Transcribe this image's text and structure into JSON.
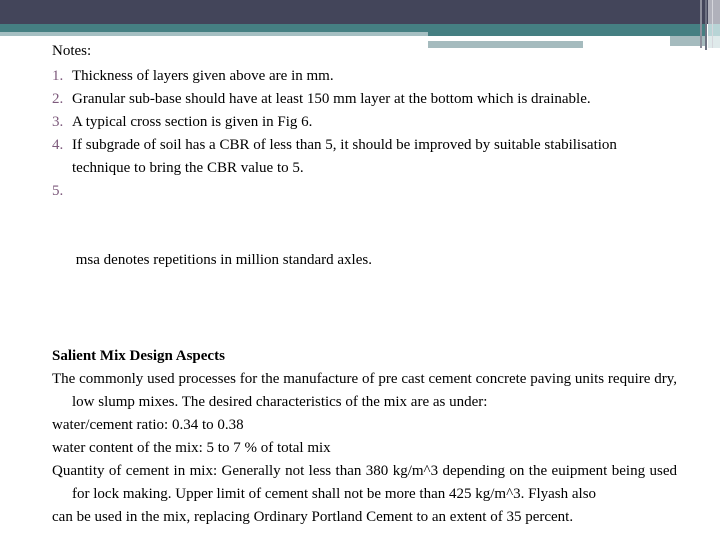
{
  "header": {
    "colors": {
      "dark_band": "#43455a",
      "teal_band": "#457f82",
      "light_strip": "#a5bfc2"
    }
  },
  "notes": {
    "title": "Notes:",
    "number_color": "#7d5a7c",
    "items": [
      {
        "num": "1.",
        "text": "Thickness of layers given above are in mm."
      },
      {
        "num": "2.",
        "text": "Granular sub-base should have at least 150 mm layer at the bottom which is drainable."
      },
      {
        "num": "3.",
        "text": "A typical cross section is given in Fig 6."
      },
      {
        "num": "4.",
        "text": "If subgrade of soil has a CBR of less than 5, it should be improved by suitable stabilisation technique to bring the CBR value to 5."
      },
      {
        "num": "5.",
        "text": " msa denotes repetitions in million standard axles."
      }
    ]
  },
  "mix_design": {
    "heading": "Salient Mix Design Aspects",
    "intro": "The commonly used processes for the manufacture of pre cast cement concrete paving units require dry, low slump mixes. The desired characteristics of the mix are as under:",
    "wc_ratio": "water/cement ratio: 0.34 to 0.38",
    "water_content": "water content of the mix: 5 to 7 % of total mix",
    "cement_quantity": "Quantity of cement in mix: Generally not less than 380 kg/m^3 depending on the euipment being used for lock making. Upper limit of cement shall not be more than 425 kg/m^3. Flyash also",
    "flyash": "can be used in the mix, replacing Ordinary Portland Cement to an extent of 35 percent."
  }
}
